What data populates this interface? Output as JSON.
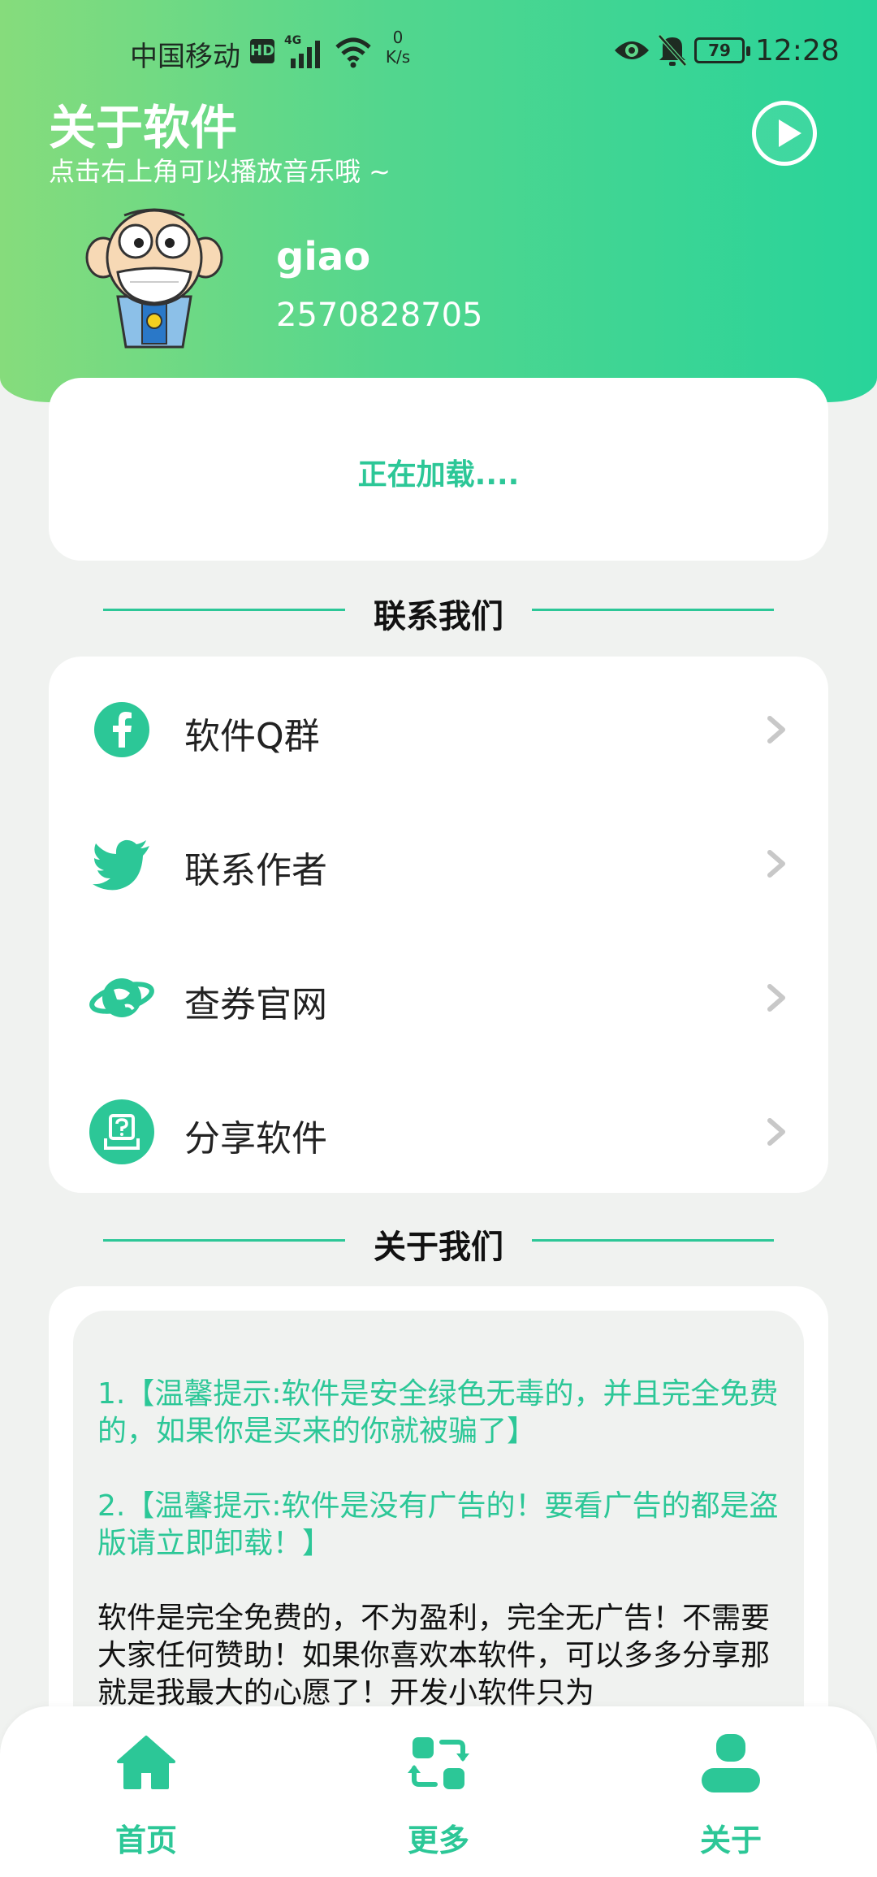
{
  "colors": {
    "accent": "#2cc797",
    "header_start": "#86dc7c",
    "header_end": "#28d49a",
    "background": "#f0f2f0"
  },
  "status_bar": {
    "carrier": "中国移动",
    "hd": "HD",
    "speed_value": "0",
    "speed_unit": "K/s",
    "battery": "79",
    "time": "12:28"
  },
  "header": {
    "title": "关于软件",
    "subtitle": "点击右上角可以播放音乐哦 ~",
    "play_icon": "play-icon"
  },
  "user": {
    "name": "giao",
    "id": "2570828705"
  },
  "loading": {
    "text": "正在加载...."
  },
  "contact_section": {
    "title": "联系我们",
    "items": [
      {
        "label": "软件Q群",
        "icon": "facebook-icon"
      },
      {
        "label": "联系作者",
        "icon": "twitter-icon"
      },
      {
        "label": "查券官网",
        "icon": "planet-icon"
      },
      {
        "label": "分享软件",
        "icon": "help-box-icon"
      }
    ]
  },
  "about_section": {
    "title": "关于我们",
    "paragraphs": [
      "1.【温馨提示:软件是安全绿色无毒的，并且完全免费的，如果你是买来的你就被骗了】",
      "2.【温馨提示:软件是没有广告的！要看广告的都是盗版请立即卸载！】",
      "软件是完全免费的，不为盈利，完全无广告！不需要大家任何赞助！如果你喜欢本软件，可以多多分享那就是我最大的心愿了！开发小软件只为"
    ]
  },
  "bottom_nav": [
    {
      "label": "首页",
      "icon": "home-icon"
    },
    {
      "label": "更多",
      "icon": "swap-icon"
    },
    {
      "label": "关于",
      "icon": "user-icon"
    }
  ]
}
